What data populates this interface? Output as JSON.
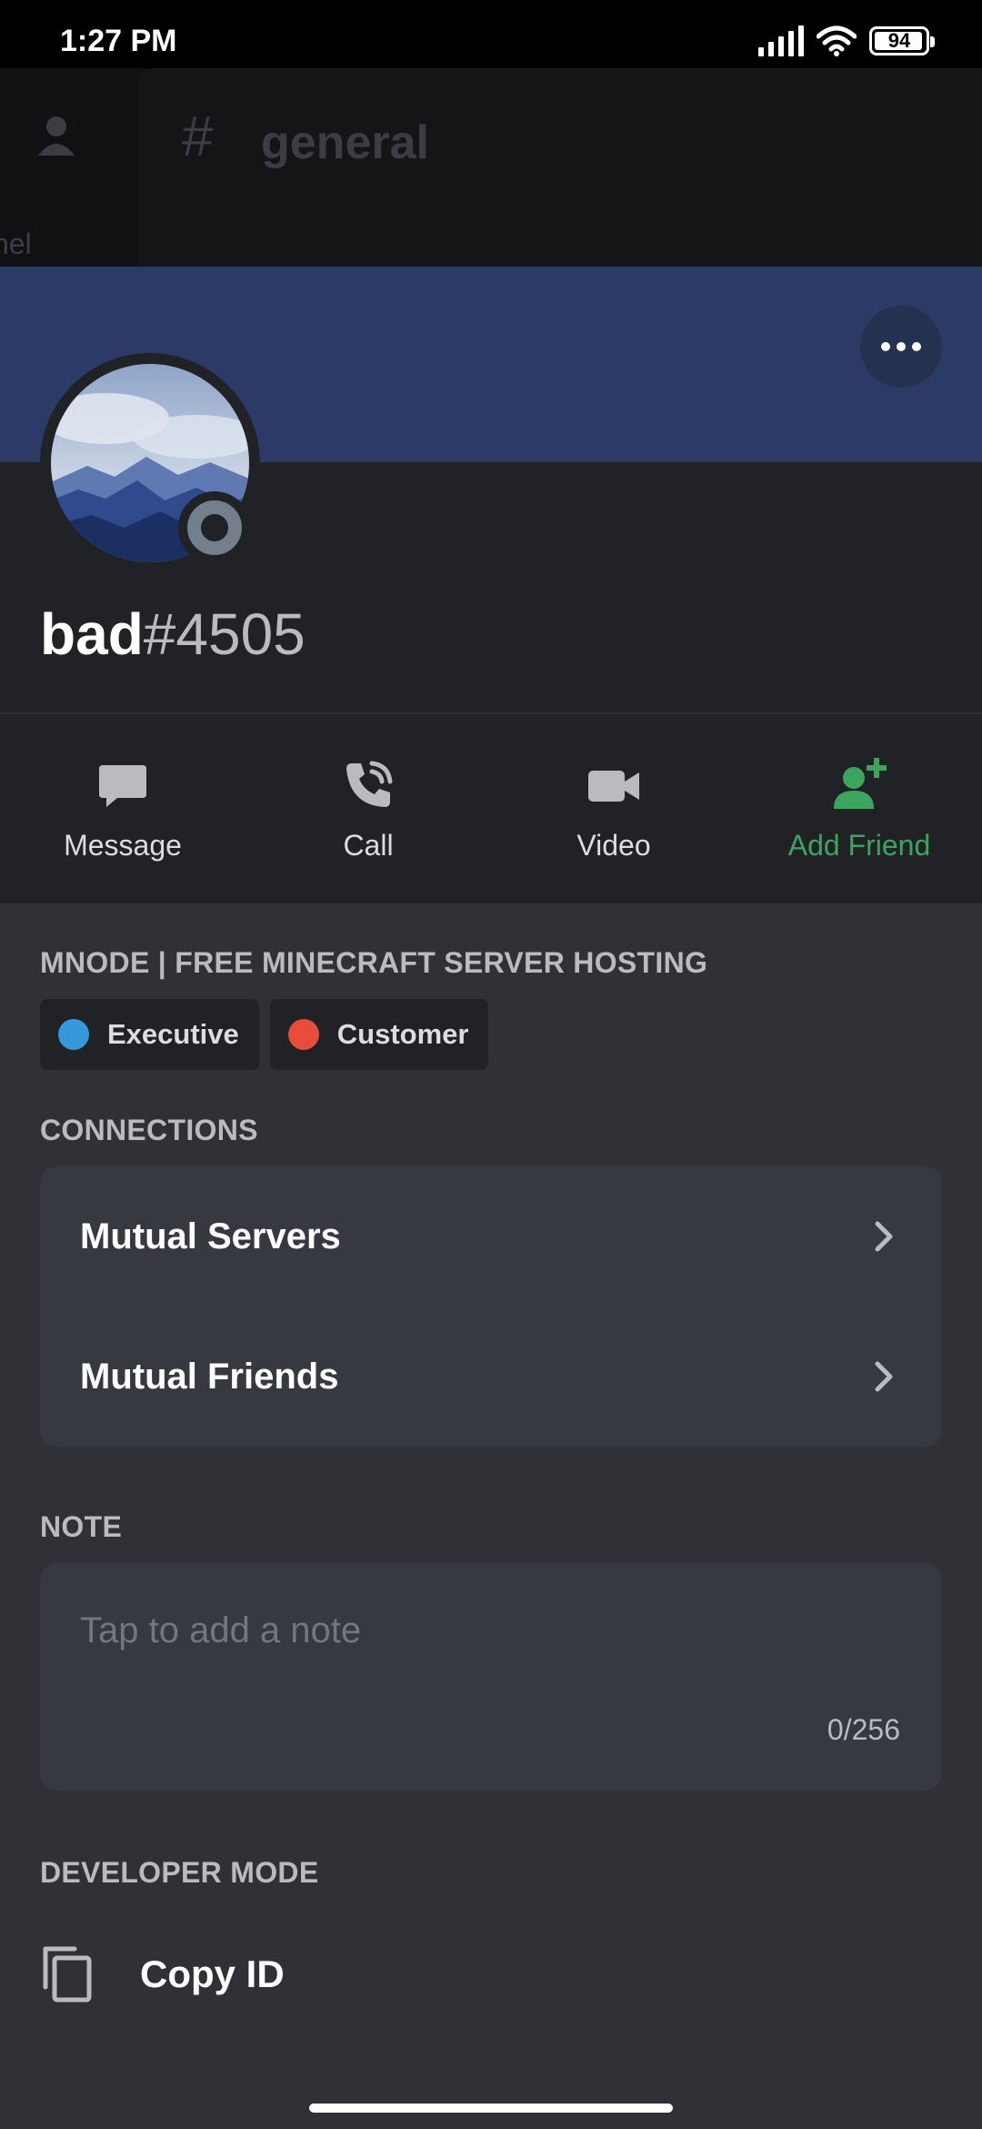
{
  "status_bar": {
    "time": "1:27 PM",
    "battery": "94"
  },
  "background_channel": {
    "hash": "#",
    "name": "general",
    "left_text": "nel"
  },
  "profile": {
    "username": "bad",
    "discriminator": "#4505",
    "status": "offline",
    "banner_color": "#2b3a66"
  },
  "actions": [
    {
      "label": "Message",
      "icon": "chat-bubble-icon"
    },
    {
      "label": "Call",
      "icon": "phone-call-icon"
    },
    {
      "label": "Video",
      "icon": "video-camera-icon"
    },
    {
      "label": "Add Friend",
      "icon": "add-friend-icon"
    }
  ],
  "server_section": {
    "title": "MNODE | FREE MINECRAFT SERVER HOSTING",
    "roles": [
      {
        "name": "Executive",
        "color": "#3498db"
      },
      {
        "name": "Customer",
        "color": "#e74c3c"
      }
    ]
  },
  "connections": {
    "title": "CONNECTIONS",
    "items": [
      {
        "label": "Mutual Servers"
      },
      {
        "label": "Mutual Friends"
      }
    ]
  },
  "note": {
    "title": "NOTE",
    "placeholder": "Tap to add a note",
    "counter": "0/256"
  },
  "developer": {
    "title": "DEVELOPER MODE",
    "copy_label": "Copy ID"
  }
}
